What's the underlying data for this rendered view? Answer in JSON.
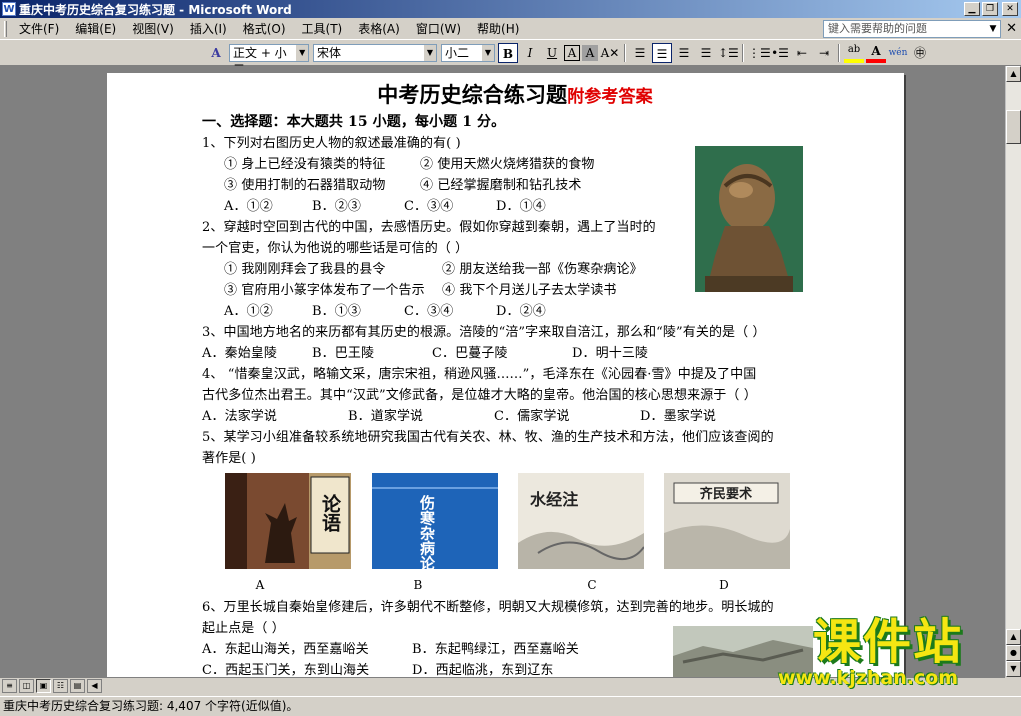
{
  "window": {
    "title": "重庆中考历史综合复习练习题 - Microsoft Word",
    "app_icon": "W"
  },
  "menu": {
    "items": [
      "文件(F)",
      "编辑(E)",
      "视图(V)",
      "插入(I)",
      "格式(O)",
      "工具(T)",
      "表格(A)",
      "窗口(W)",
      "帮助(H)"
    ],
    "help_placeholder": "键入需要帮助的问题"
  },
  "toolbar": {
    "style": "正文 + 小二",
    "font": "宋体",
    "size": "小二",
    "bold": "B",
    "italic": "I",
    "underline": "U",
    "char_border": "A",
    "char_shading": "A",
    "highlight": "ab",
    "font_color": "A",
    "phonetic": "wén"
  },
  "document": {
    "title_main": "中考历史综合练习题",
    "title_red": "附参考答案",
    "section1": "一、选择题：本大题共 15 小题，每小题 1 分。",
    "q1": {
      "stem": "1、下列对右图历史人物的叙述最准确的有(    )",
      "o1": "①  身上已经没有猿类的特征",
      "o2": "②  使用天燃火烧烤猎获的食物",
      "o3": "③  使用打制的石器猎取动物",
      "o4": "④  已经掌握磨制和钻孔技术",
      "a": "A．①②",
      "b": "B．②③",
      "c": "C．③④",
      "d": "D．①④"
    },
    "q2": {
      "stem1": "2、穿越时空回到古代的中国，去感悟历史。假如你穿越到秦朝，遇上了当时的",
      "stem2": "一个官吏，你认为他说的哪些话是可信的（    ）",
      "o1": "①  我刚刚拜会了我县的县令",
      "o2": "②  朋友送给我一部《伤寒杂病论》",
      "o3": "③  官府用小篆字体发布了一个告示",
      "o4": "④  我下个月送儿子去太学读书",
      "a": "A．①②",
      "b": "B．①③",
      "c": "C．③④",
      "d": "D．②④"
    },
    "q3": {
      "stem": "3、中国地方地名的来历都有其历史的根源。涪陵的“涪”字来取自涪江，那么和“陵”有关的是（    ）",
      "a": "A．秦始皇陵",
      "b": "B．巴王陵",
      "c": "C．巴蔓子陵",
      "d": "D．明十三陵"
    },
    "q4": {
      "stem1": "4、 “惜秦皇汉武，略输文采，唐宗宋祖，稍逊风骚……”，毛泽东在《沁园春·雪》中提及了中国",
      "stem2": "古代多位杰出君王。其中“汉武”文修武备，是位雄才大略的皇帝。他治国的核心思想来源于（    ）",
      "a": "A．法家学说",
      "b": "B．道家学说",
      "c": "C．儒家学说",
      "d": "D．墨家学说"
    },
    "q5": {
      "stem1": "5、某学习小组准备较系统地研究我国古代有关农、林、牧、渔的生产技术和方法，他们应该查阅的",
      "stem2": "著作是(    )",
      "books": [
        {
          "cover": "论语",
          "label": "A"
        },
        {
          "cover": "伤寒杂病论",
          "label": "B"
        },
        {
          "cover": "水经注",
          "label": "C"
        },
        {
          "cover": "齐民要术",
          "label": "D"
        }
      ]
    },
    "q6": {
      "stem1": "6、万里长城自秦始皇修建后，许多朝代不断整修，明朝又大规模修筑，达到完善的地步。明长城的",
      "stem2": "起止点是（    ）",
      "a": "A．东起山海关，西至嘉峪关",
      "b": "B．东起鸭绿江，西至嘉峪关",
      "c": "C．西起玉门关，东到山海关",
      "d": "D．西起临洮，东到辽东"
    }
  },
  "watermark": {
    "big": "课件站",
    "small": "www.kjzhan.com"
  },
  "status": {
    "text": "重庆中考历史综合复习练习题: 4,407 个字符(近似值)。"
  },
  "colors": {
    "title_red": "#e00000",
    "watermark_yellow": "#f5e612",
    "watermark_green": "#1c7a1c"
  }
}
